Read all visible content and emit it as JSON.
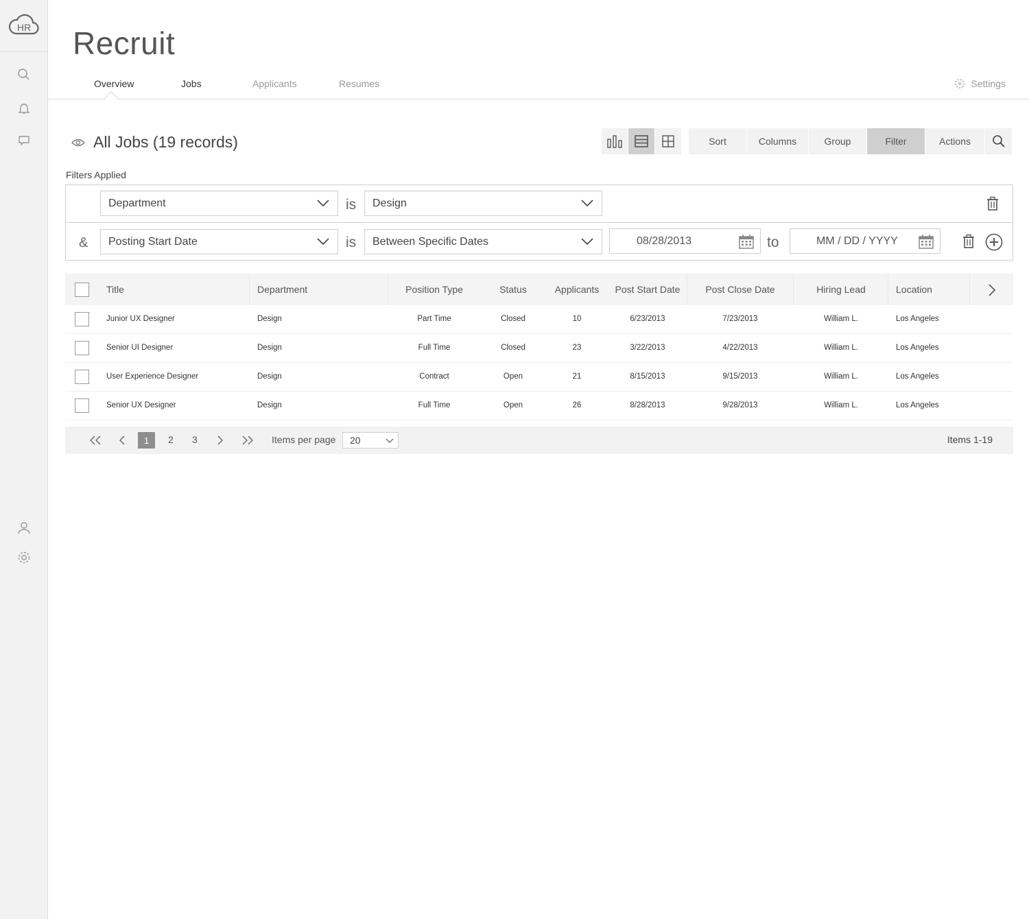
{
  "sidebar": {
    "logo_text": "HR",
    "icons": [
      "search-icon",
      "bell-icon",
      "chat-icon",
      "user-icon",
      "gear-icon"
    ]
  },
  "header": {
    "app_title": "Recruit",
    "tabs": [
      {
        "label": "Overview",
        "active": true
      },
      {
        "label": "Jobs",
        "active": false
      },
      {
        "label": "Applicants",
        "active": false
      },
      {
        "label": "Resumes",
        "active": false
      }
    ],
    "settings_label": "Settings"
  },
  "page": {
    "title": "All Jobs (19 records)"
  },
  "toolbar": {
    "views": [
      "chart-view-icon",
      "list-view-icon",
      "grid-view-icon"
    ],
    "active_view": "list-view-icon",
    "sort": "Sort",
    "columns": "Columns",
    "group": "Group",
    "filter": "Filter",
    "actions": "Actions",
    "active_action": "Filter"
  },
  "filters": {
    "label": "Filters Applied",
    "rows": [
      {
        "conjunction": "",
        "field": "Department",
        "operator": "is",
        "value": "Design"
      },
      {
        "conjunction": "&",
        "field": "Posting Start Date",
        "operator": "is",
        "value": "Between Specific Dates",
        "from": "08/28/2013",
        "to_label": "to",
        "to_placeholder": "MM / DD / YYYY"
      }
    ]
  },
  "table": {
    "headers": [
      "Title",
      "Department",
      "Position Type",
      "Status",
      "Applicants",
      "Post Start Date",
      "Post Close Date",
      "Hiring Lead",
      "Location"
    ],
    "rows": [
      [
        "Junior UX Designer",
        "Design",
        "Part Time",
        "Closed",
        "10",
        "6/23/2013",
        "7/23/2013",
        "William L.",
        "Los Angeles"
      ],
      [
        "Senior UI Designer",
        "Design",
        "Full Time",
        "Closed",
        "23",
        "3/22/2013",
        "4/22/2013",
        "William L.",
        "Los Angeles"
      ],
      [
        "User Experience Designer",
        "Design",
        "Contract",
        "Open",
        "21",
        "8/15/2013",
        "9/15/2013",
        "William L.",
        "Los Angeles"
      ],
      [
        "Senior UX Designer",
        "Design",
        "Full Time",
        "Open",
        "26",
        "8/28/2013",
        "9/28/2013",
        "William L.",
        "Los Angeles"
      ]
    ]
  },
  "pagination": {
    "pages": [
      "1",
      "2",
      "3"
    ],
    "current": "1",
    "items_per_page_label": "Items per page",
    "items_per_page": "20",
    "info": "Items 1-19"
  }
}
